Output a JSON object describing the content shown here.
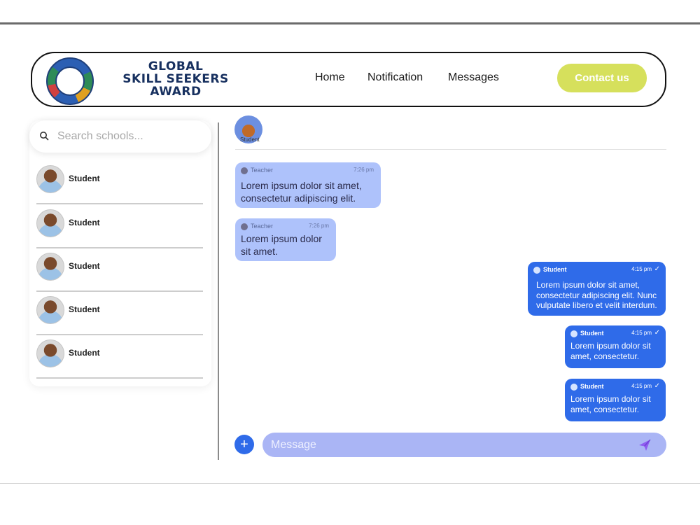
{
  "header": {
    "logo_title_lines": [
      "GLOBAL",
      "SKILL SEEKERS",
      "AWARD"
    ],
    "nav": [
      {
        "label": "Home"
      },
      {
        "label": "Notification"
      },
      {
        "label": "Messages"
      }
    ],
    "contact_label": "Contact us",
    "accent_color": "#d6e05c"
  },
  "sidebar": {
    "search_placeholder": "Search schools...",
    "contacts": [
      {
        "name": "Student"
      },
      {
        "name": "Student"
      },
      {
        "name": "Student"
      },
      {
        "name": "Student"
      },
      {
        "name": "Student"
      }
    ]
  },
  "chat": {
    "header_name": "Student",
    "messages": [
      {
        "direction": "in",
        "sender": "Teacher",
        "time": "7:26 pm",
        "text": "Lorem ipsum dolor sit amet, consectetur adipiscing elit."
      },
      {
        "direction": "in",
        "sender": "Teacher",
        "time": "7:26 pm",
        "text": "Lorem ipsum dolor sit amet."
      },
      {
        "direction": "out",
        "sender": "Student",
        "time": "4:15 pm",
        "check": "✓",
        "text": "Lorem ipsum dolor sit amet, consectetur adipiscing elit. Nunc vulputate libero et velit interdum."
      },
      {
        "direction": "out",
        "sender": "Student",
        "time": "4:15 pm",
        "check": "✓",
        "text": "Lorem ipsum dolor sit amet, consectetur."
      },
      {
        "direction": "out",
        "sender": "Student",
        "time": "4:15 pm",
        "check": "✓",
        "text": "Lorem ipsum dolor sit amet, consectetur."
      }
    ],
    "composer_placeholder": "Message",
    "add_button_glyph": "+",
    "incoming_bubble_color": "#aec2fb",
    "outgoing_bubble_color": "#2f6be9"
  }
}
